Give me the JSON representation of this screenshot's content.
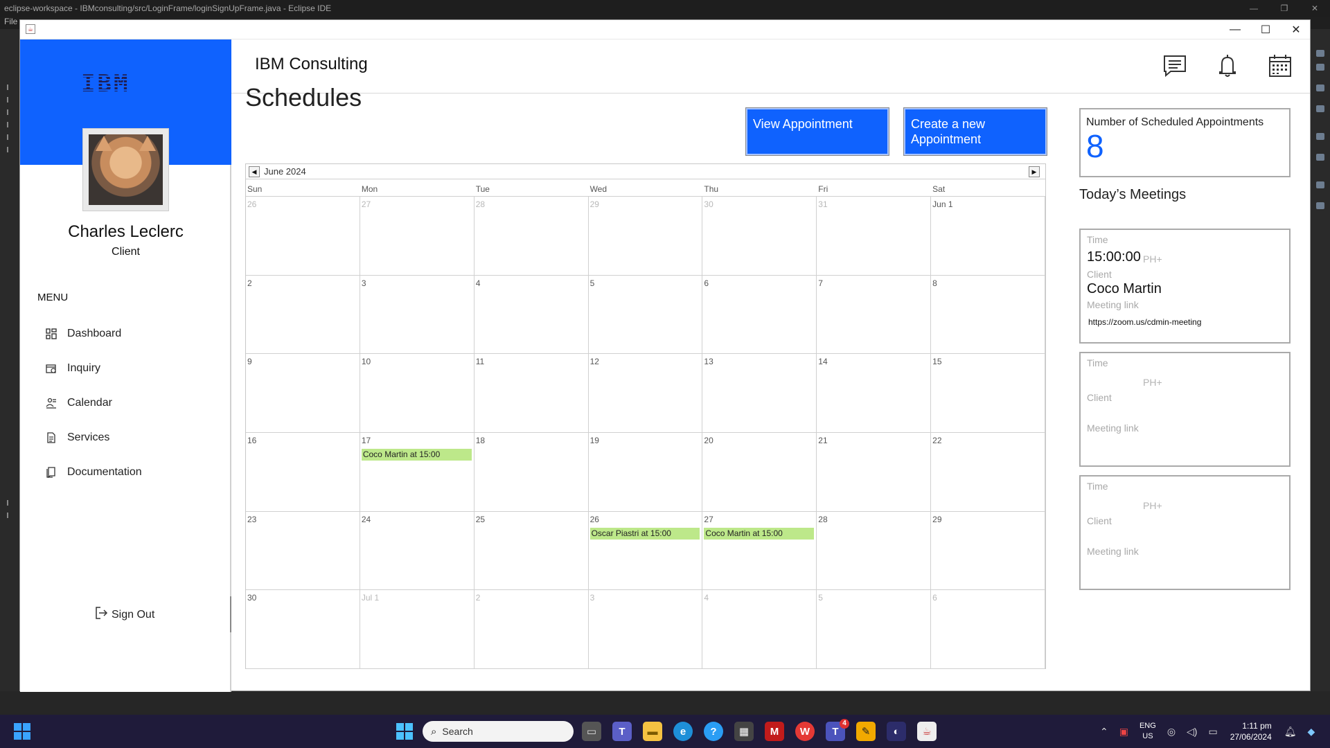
{
  "eclipse": {
    "title": "eclipse-workspace - IBMconsulting/src/LoginFrame/loginSignUpFrame.java - Eclipse IDE",
    "menu_file": "File"
  },
  "sidebar": {
    "user_name": "Charles Leclerc",
    "user_role": "Client",
    "menu_label": "MENU",
    "items": [
      {
        "label": "Dashboard",
        "icon": "dashboard-icon"
      },
      {
        "label": "Inquiry",
        "icon": "inquiry-icon"
      },
      {
        "label": "Calendar",
        "icon": "calendar-icon"
      },
      {
        "label": "Services",
        "icon": "services-icon"
      },
      {
        "label": "Documentation",
        "icon": "documentation-icon"
      }
    ],
    "sign_out": "Sign Out"
  },
  "header": {
    "title": "IBM Consulting",
    "icons": [
      "message-icon",
      "bell-icon",
      "calendar-grid-icon"
    ]
  },
  "main": {
    "title": "Schedules",
    "view_btn": "View Appointment",
    "create_btn": "Create a new Appointment"
  },
  "calendar": {
    "month": "June 2024",
    "weekdays": [
      "Sun",
      "Mon",
      "Tue",
      "Wed",
      "Thu",
      "Fri",
      "Sat"
    ],
    "weeks": [
      [
        {
          "d": "26",
          "out": true
        },
        {
          "d": "27",
          "out": true
        },
        {
          "d": "28",
          "out": true
        },
        {
          "d": "29",
          "out": true
        },
        {
          "d": "30",
          "out": true
        },
        {
          "d": "31",
          "out": true
        },
        {
          "d": "Jun 1",
          "out": false
        }
      ],
      [
        {
          "d": "2"
        },
        {
          "d": "3"
        },
        {
          "d": "4"
        },
        {
          "d": "5"
        },
        {
          "d": "6"
        },
        {
          "d": "7"
        },
        {
          "d": "8"
        }
      ],
      [
        {
          "d": "9"
        },
        {
          "d": "10"
        },
        {
          "d": "11"
        },
        {
          "d": "12"
        },
        {
          "d": "13"
        },
        {
          "d": "14"
        },
        {
          "d": "15"
        }
      ],
      [
        {
          "d": "16"
        },
        {
          "d": "17",
          "event": "Coco Martin at 15:00"
        },
        {
          "d": "18"
        },
        {
          "d": "19"
        },
        {
          "d": "20"
        },
        {
          "d": "21"
        },
        {
          "d": "22"
        }
      ],
      [
        {
          "d": "23"
        },
        {
          "d": "24"
        },
        {
          "d": "25"
        },
        {
          "d": "26",
          "event": "Oscar Piastri at 15:00"
        },
        {
          "d": "27",
          "event": "Coco Martin at 15:00"
        },
        {
          "d": "28"
        },
        {
          "d": "29"
        }
      ],
      [
        {
          "d": "30"
        },
        {
          "d": "Jul 1",
          "out": true
        },
        {
          "d": "2",
          "out": true
        },
        {
          "d": "3",
          "out": true
        },
        {
          "d": "4",
          "out": true
        },
        {
          "d": "5",
          "out": true
        },
        {
          "d": "6",
          "out": true
        }
      ]
    ],
    "event_color": "#bde88a"
  },
  "summary": {
    "count_label": "Number of Scheduled Appointments",
    "count_value": "8"
  },
  "today": {
    "title": "Today’s Meetings",
    "time_label": "Time",
    "client_label": "Client",
    "link_label": "Meeting link",
    "tz": "PH+",
    "meetings": [
      {
        "time": "15:00:00",
        "client": "Coco Martin",
        "link": "https://zoom.us/cdmin-meeting"
      },
      {
        "time": "",
        "client": "",
        "link": ""
      },
      {
        "time": "",
        "client": "",
        "link": ""
      }
    ]
  },
  "taskbar": {
    "search_placeholder": "Search",
    "lang_top": "ENG",
    "lang_bottom": "US",
    "time": "1:11 pm",
    "date": "27/06/2024",
    "badge": "4"
  },
  "colors": {
    "brand_blue": "#0f62fe",
    "taskbar": "#1f1b3a"
  }
}
